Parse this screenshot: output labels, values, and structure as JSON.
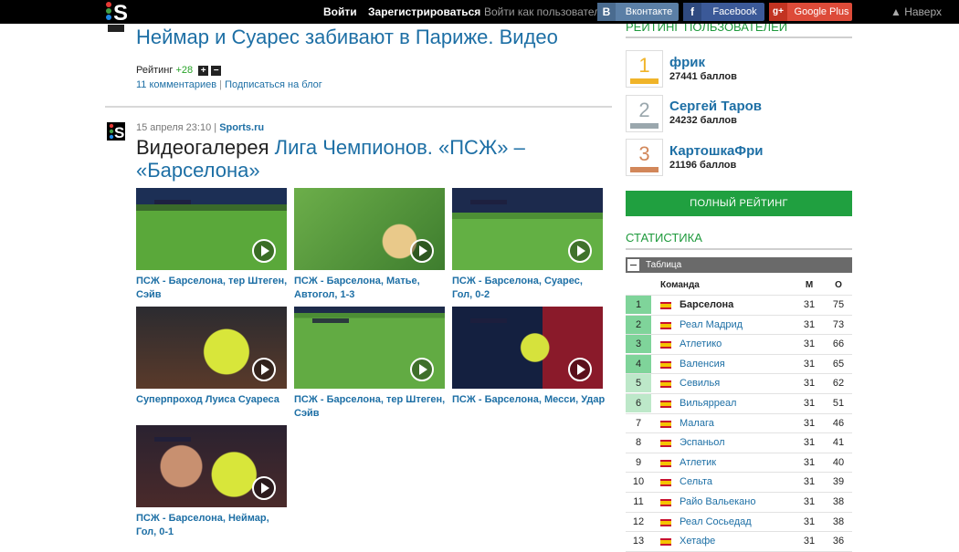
{
  "topbar": {
    "login": "Войти",
    "register": "Зарегистрироваться",
    "login_as": "Войти как пользователь",
    "social": [
      {
        "label": "Вконтакте",
        "icon": "В",
        "color": "#5b7fa6"
      },
      {
        "label": "Facebook",
        "icon": "f",
        "color": "#3b5998"
      },
      {
        "label": "Google Plus",
        "icon": "g+",
        "color": "#dd4b39"
      }
    ],
    "back_top": "▲ Наверх"
  },
  "post1": {
    "title": "Неймар и Суарес забивают в Париже. Видео",
    "rating_label": "Рейтинг",
    "rating_value": "+28",
    "plus": "+",
    "minus": "−",
    "comments": "11 комментариев",
    "sep": "|",
    "subscribe": "Подписаться на блог"
  },
  "post2": {
    "date": "15 апреля 23:10",
    "sep": "|",
    "source": "Sports.ru",
    "title_prefix": "Видеогалерея",
    "title_link": "Лига Чемпионов. «ПСЖ» – «Барселона»",
    "videos": [
      {
        "caption": "ПСЖ - Барселона, тер Штеген, Сэйв"
      },
      {
        "caption": "ПСЖ - Барселона, Матье, Автогол, 1-3"
      },
      {
        "caption": "ПСЖ - Барселона, Суарес, Гол, 0-2"
      },
      {
        "caption": "Суперпроход Луиса Суареса"
      },
      {
        "caption": "ПСЖ - Барселона, тер Штеген, Сэйв"
      },
      {
        "caption": "ПСЖ - Барселона, Месси, Удар"
      },
      {
        "caption": "ПСЖ - Барселона, Неймар, Гол, 0-1"
      }
    ]
  },
  "users_rating": {
    "heading": "Рейтинг пользователей",
    "users": [
      {
        "place": "1",
        "name": "фрик",
        "points": "27441 баллов",
        "color": "#f0b429"
      },
      {
        "place": "2",
        "name": "Сергей Таров",
        "points": "24232 баллов",
        "color": "#9aa7ad"
      },
      {
        "place": "3",
        "name": "КартошкаФри",
        "points": "21196 баллов",
        "color": "#d2875a"
      }
    ],
    "full_button": "ПОЛНЫЙ РЕЙТИНГ"
  },
  "stats": {
    "heading": "Статистика",
    "table_label": "Таблица",
    "headers": {
      "team": "Команда",
      "m": "М",
      "o": "О"
    },
    "rows": [
      {
        "pos": "1",
        "team": "Барселона",
        "m": "31",
        "o": "75"
      },
      {
        "pos": "2",
        "team": "Реал Мадрид",
        "m": "31",
        "o": "73"
      },
      {
        "pos": "3",
        "team": "Атлетико",
        "m": "31",
        "o": "66"
      },
      {
        "pos": "4",
        "team": "Валенсия",
        "m": "31",
        "o": "65"
      },
      {
        "pos": "5",
        "team": "Севилья",
        "m": "31",
        "o": "62"
      },
      {
        "pos": "6",
        "team": "Вильярреал",
        "m": "31",
        "o": "51"
      },
      {
        "pos": "7",
        "team": "Малага",
        "m": "31",
        "o": "46"
      },
      {
        "pos": "8",
        "team": "Эспаньол",
        "m": "31",
        "o": "41"
      },
      {
        "pos": "9",
        "team": "Атлетик",
        "m": "31",
        "o": "40"
      },
      {
        "pos": "10",
        "team": "Сельта",
        "m": "31",
        "o": "39"
      },
      {
        "pos": "11",
        "team": "Райо Вальекано",
        "m": "31",
        "o": "38"
      },
      {
        "pos": "12",
        "team": "Реал Сосьедад",
        "m": "31",
        "o": "38"
      },
      {
        "pos": "13",
        "team": "Хетафе",
        "m": "31",
        "o": "36"
      }
    ],
    "pos_colors": {
      "cl": "#7fd49a",
      "el": "#bde8c9",
      "other": "#ffffff"
    }
  }
}
